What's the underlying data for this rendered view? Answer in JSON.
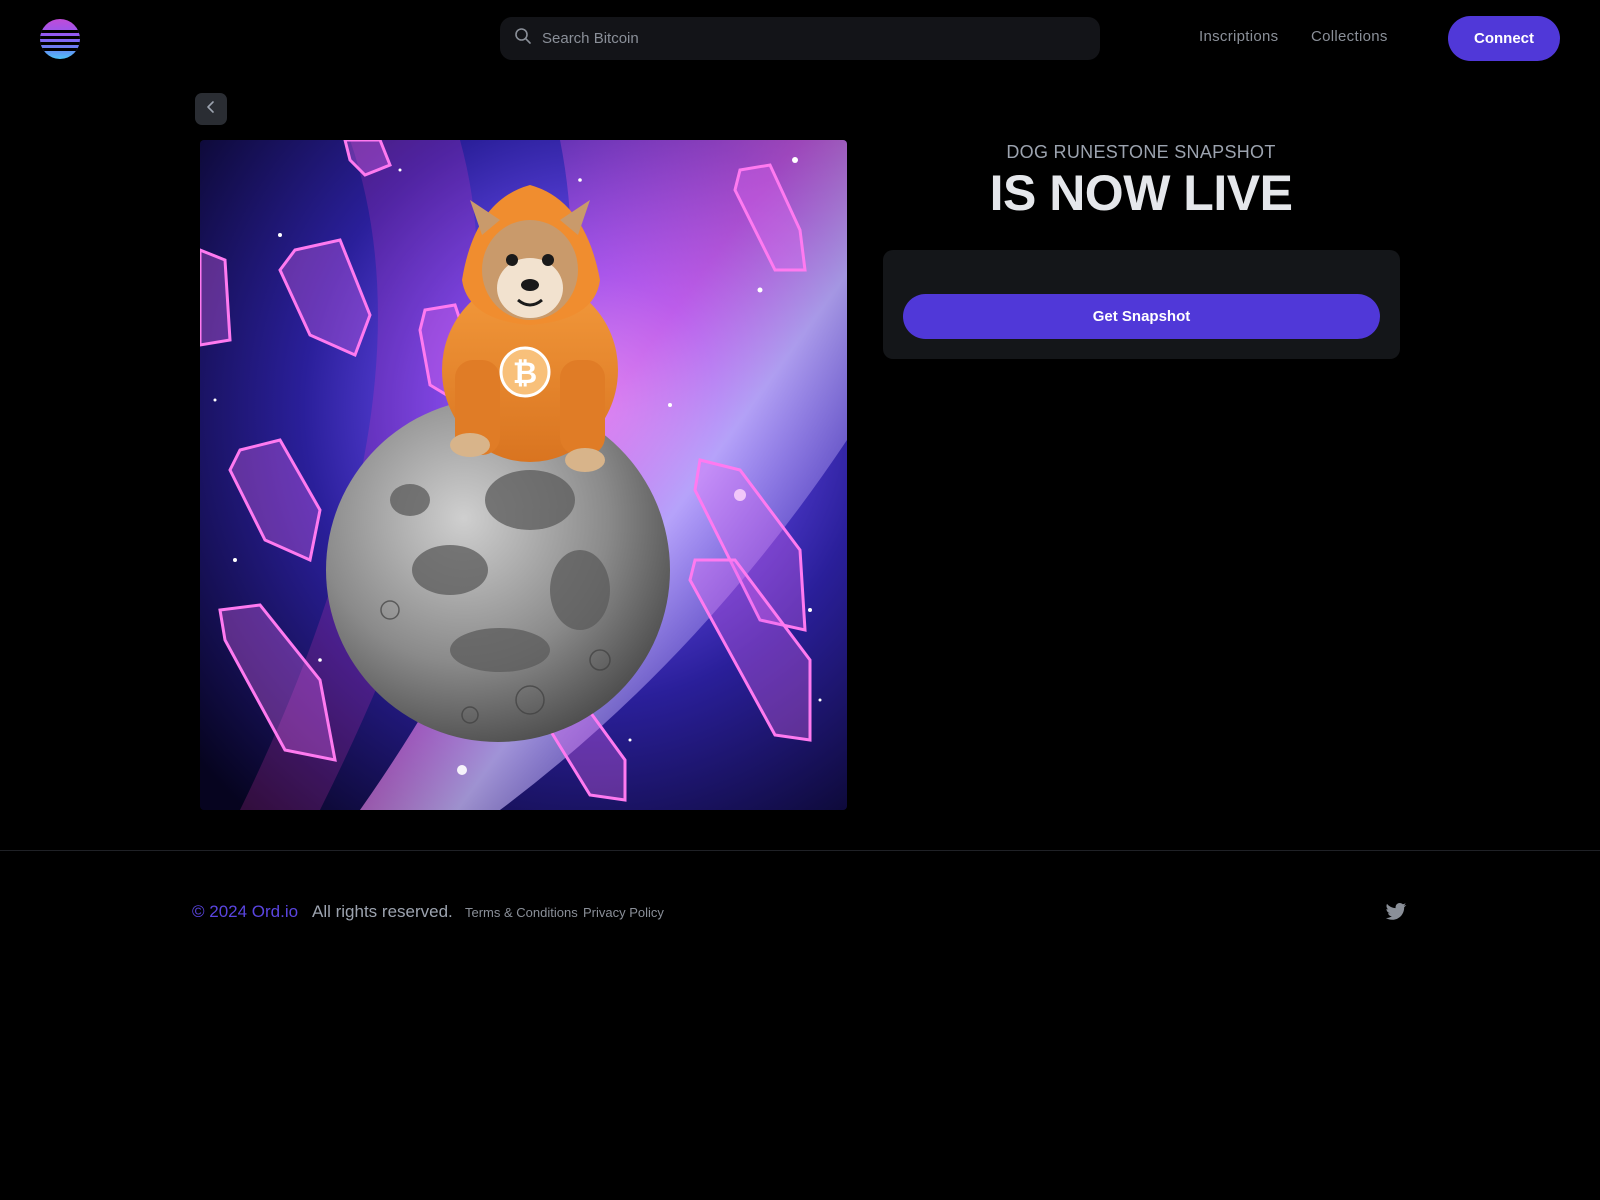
{
  "header": {
    "logo_icon": "ord-io-striped-circle-logo",
    "search": {
      "placeholder": "Search Bitcoin",
      "icon": "search-icon"
    },
    "nav": [
      {
        "label": "Inscriptions"
      },
      {
        "label": "Collections"
      }
    ],
    "connect_label": "Connect"
  },
  "back_icon": "chevron-left-icon",
  "artwork": {
    "alt": "Dog in orange Bitcoin hoodie sitting on the moon in space with pink crystals"
  },
  "main": {
    "subtitle": "DOG RUNESTONE SNAPSHOT",
    "headline": "IS NOW LIVE",
    "snapshot_button": "Get Snapshot"
  },
  "footer": {
    "copyright": "© 2024 Ord.io",
    "rights": "All rights reserved.",
    "links": [
      {
        "label": "Terms & Conditions"
      },
      {
        "label": "Privacy Policy"
      }
    ],
    "social_icon": "twitter-icon"
  },
  "colors": {
    "accent": "#5038d8",
    "background": "#000000",
    "card": "#141619",
    "muted_text": "#8a8f98"
  }
}
